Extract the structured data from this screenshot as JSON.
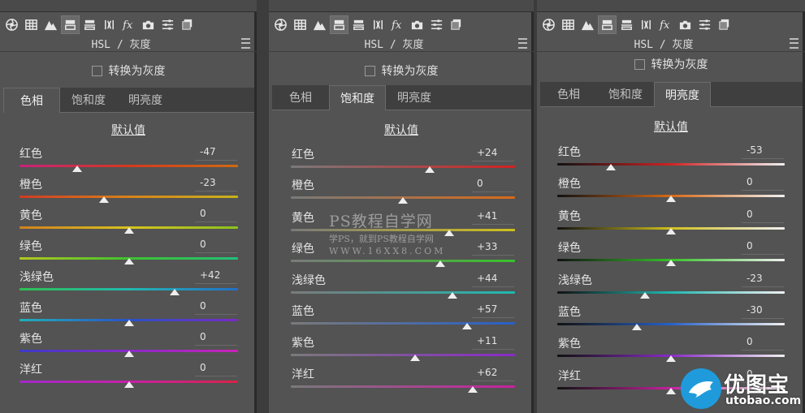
{
  "panels": [
    {
      "title": "HSL / 灰度",
      "convert_gray_label": "转换为灰度",
      "tabs": [
        "色相",
        "饱和度",
        "明亮度"
      ],
      "active_tab": 0,
      "default_label": "默认值",
      "sliders": [
        {
          "label": "红色",
          "value": "-47"
        },
        {
          "label": "橙色",
          "value": "-23"
        },
        {
          "label": "黄色",
          "value": "0"
        },
        {
          "label": "绿色",
          "value": "0"
        },
        {
          "label": "浅绿色",
          "value": "+42"
        },
        {
          "label": "蓝色",
          "value": "0"
        },
        {
          "label": "紫色",
          "value": "0"
        },
        {
          "label": "洋红",
          "value": "0"
        }
      ]
    },
    {
      "title": "HSL / 灰度",
      "convert_gray_label": "转换为灰度",
      "tabs": [
        "色相",
        "饱和度",
        "明亮度"
      ],
      "active_tab": 1,
      "default_label": "默认值",
      "sliders": [
        {
          "label": "红色",
          "value": "+24"
        },
        {
          "label": "橙色",
          "value": "0"
        },
        {
          "label": "黄色",
          "value": "+41"
        },
        {
          "label": "绿色",
          "value": "+33"
        },
        {
          "label": "浅绿色",
          "value": "+44"
        },
        {
          "label": "蓝色",
          "value": "+57"
        },
        {
          "label": "紫色",
          "value": "+11"
        },
        {
          "label": "洋红",
          "value": "+62"
        }
      ]
    },
    {
      "title": "HSL / 灰度",
      "convert_gray_label": "转换为灰度",
      "tabs": [
        "色相",
        "饱和度",
        "明亮度"
      ],
      "active_tab": 2,
      "default_label": "默认值",
      "sliders": [
        {
          "label": "红色",
          "value": "-53"
        },
        {
          "label": "橙色",
          "value": "0"
        },
        {
          "label": "黄色",
          "value": "0"
        },
        {
          "label": "绿色",
          "value": "0"
        },
        {
          "label": "浅绿色",
          "value": "-23"
        },
        {
          "label": "蓝色",
          "value": "-30"
        },
        {
          "label": "紫色",
          "value": "0"
        },
        {
          "label": "洋红",
          "value": "0"
        }
      ]
    }
  ],
  "toolbar_icons": [
    "aperture-icon",
    "grid-icon",
    "mountain-icon",
    "hsl-icon",
    "split-tone-icon",
    "lens-icon",
    "fx-icon",
    "camera-icon",
    "sliders-icon",
    "presets-icon"
  ],
  "watermark": {
    "title": "PS教程自学网",
    "subtitle": "学PS，就到PS教程自学网",
    "url": "WWW.16XX8.COM"
  },
  "logo": {
    "name": "优图宝",
    "domain": "utobao.com"
  },
  "colors": {
    "panel_bg": "#535353",
    "tab_strip_bg": "#3f3f3f",
    "thumb": "#eeeeee"
  }
}
